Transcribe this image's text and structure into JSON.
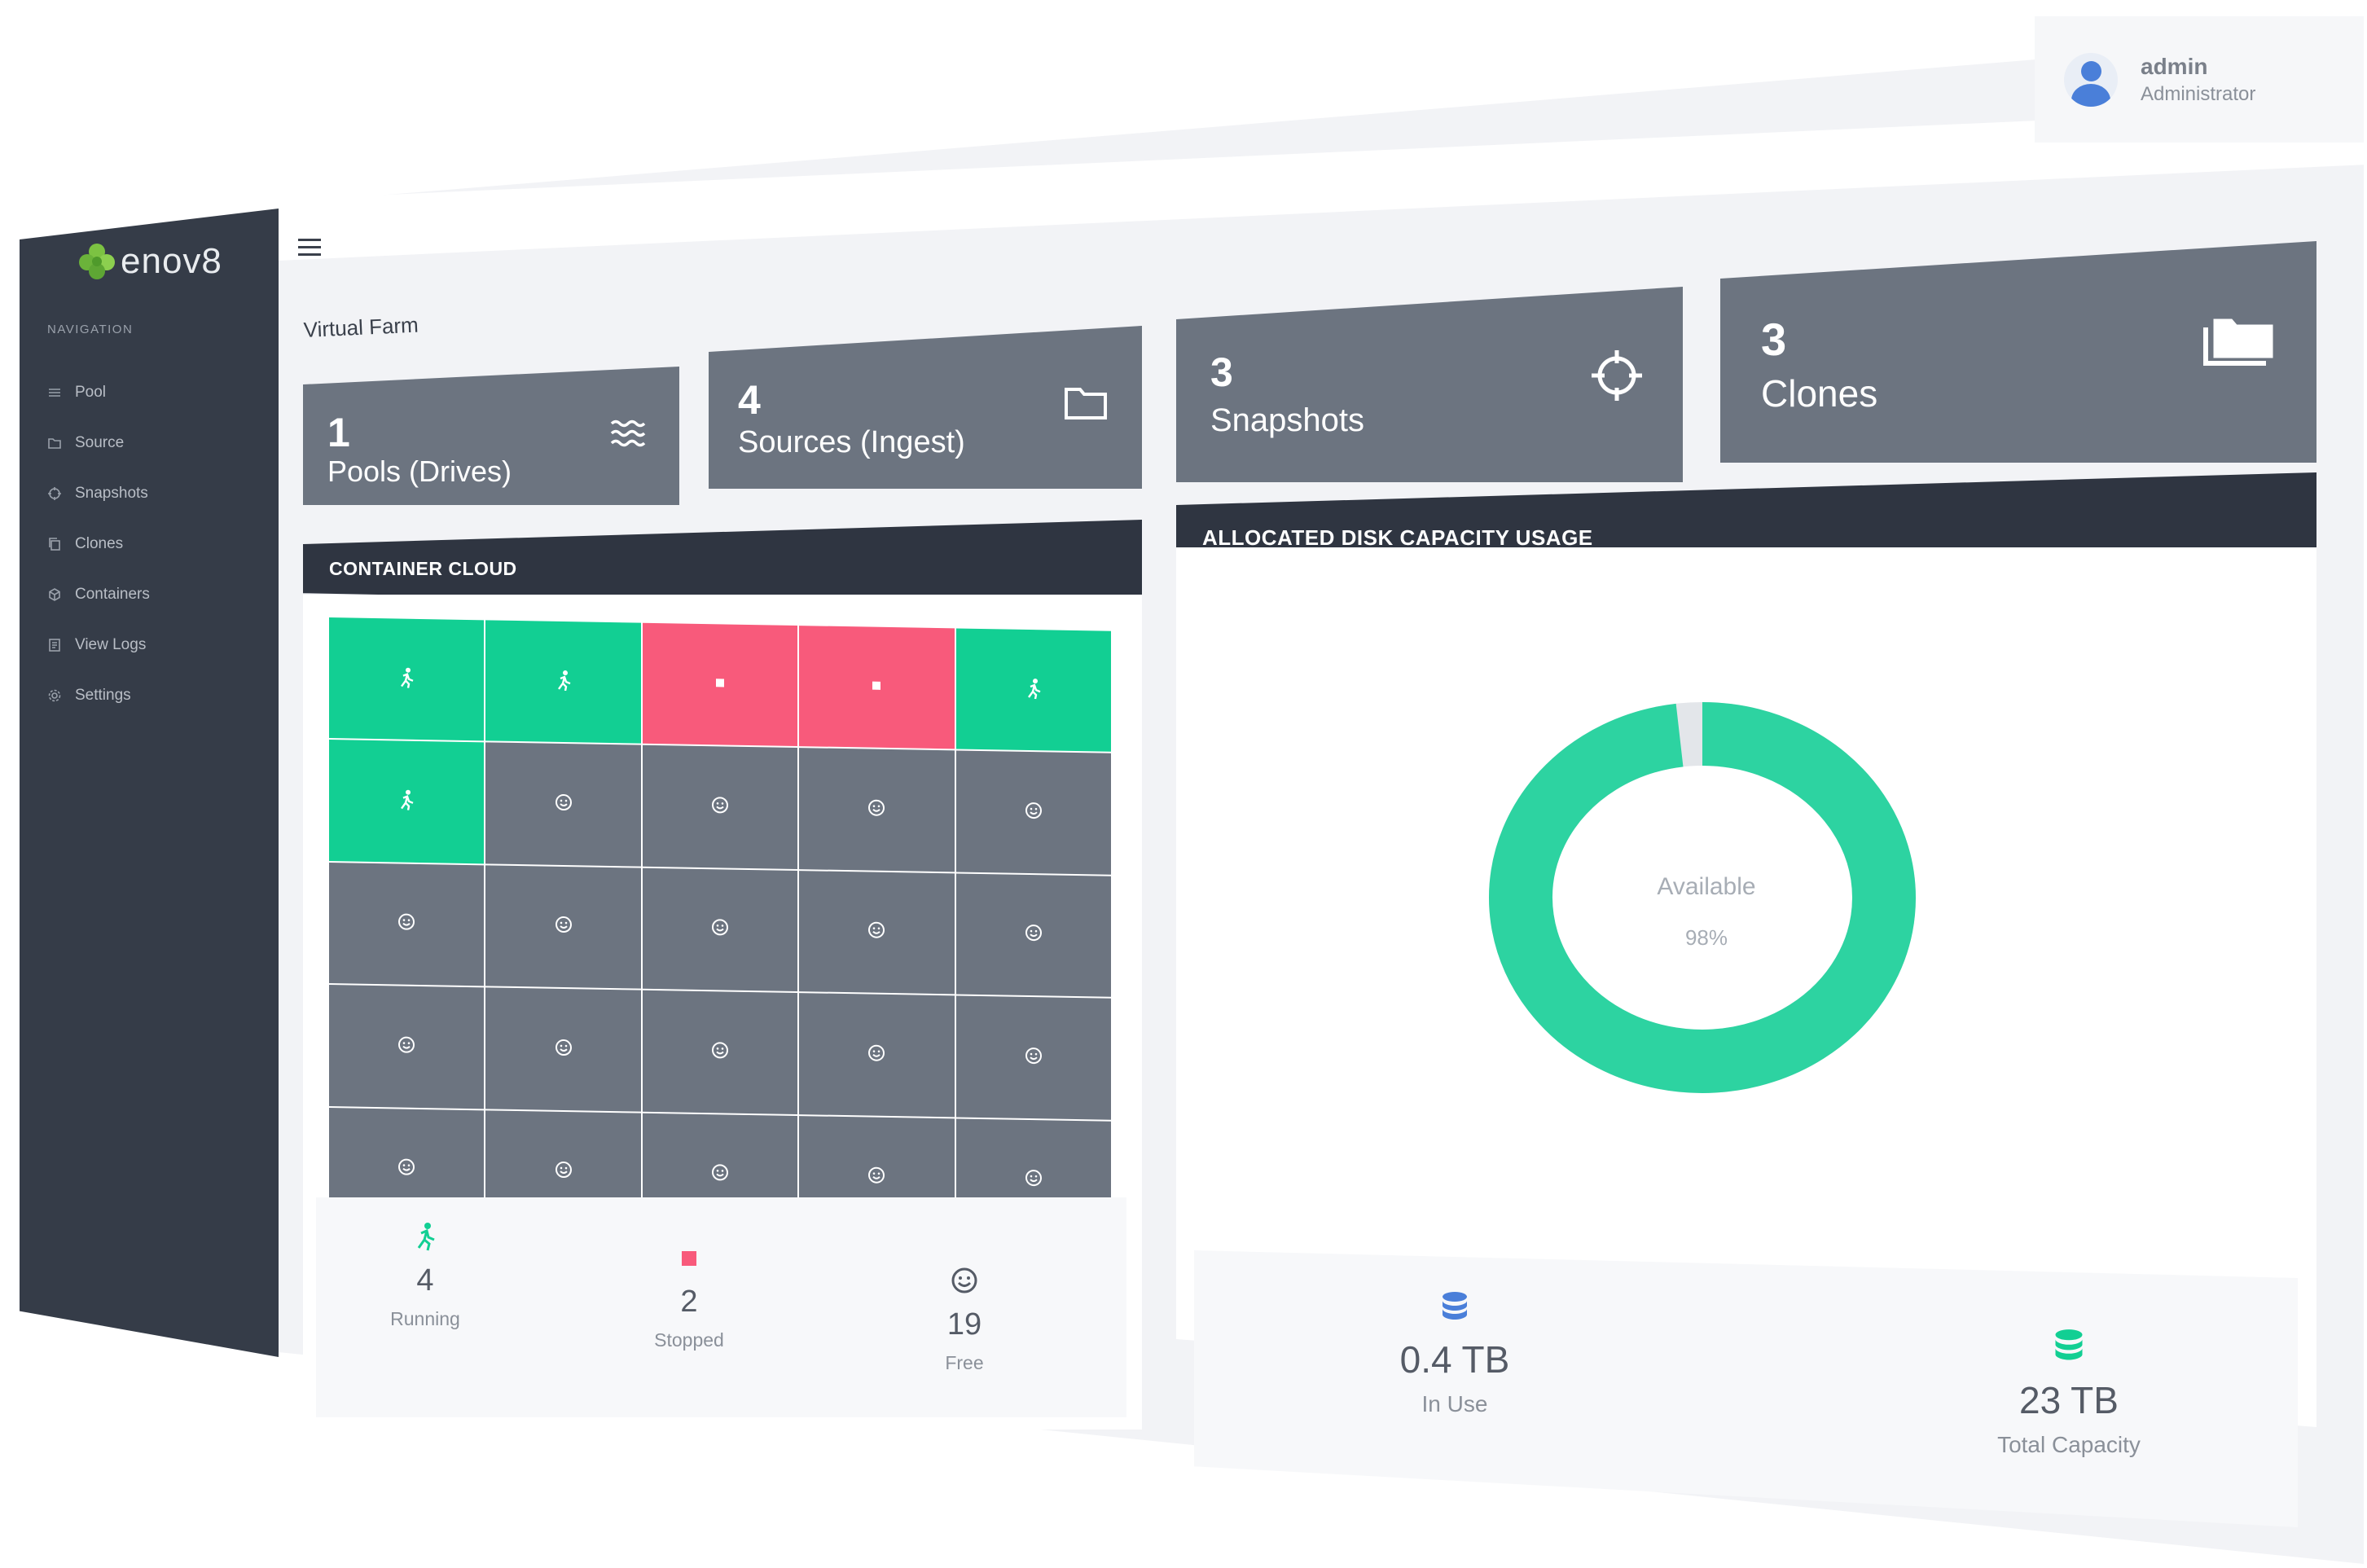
{
  "brand": {
    "name": "enov8"
  },
  "user": {
    "name": "admin",
    "role": "Administrator"
  },
  "sidebar": {
    "heading": "NAVIGATION",
    "items": [
      {
        "label": "Pool",
        "icon": "list-icon"
      },
      {
        "label": "Source",
        "icon": "folder-icon"
      },
      {
        "label": "Snapshots",
        "icon": "crosshair-icon"
      },
      {
        "label": "Clones",
        "icon": "copy-icon"
      },
      {
        "label": "Containers",
        "icon": "cube-icon"
      },
      {
        "label": "View Logs",
        "icon": "log-icon"
      },
      {
        "label": "Settings",
        "icon": "gear-icon"
      }
    ]
  },
  "page": {
    "breadcrumb": "Virtual Farm"
  },
  "stats": [
    {
      "value": "1",
      "label": "Pools (Drives)",
      "icon": "waves-icon"
    },
    {
      "value": "4",
      "label": "Sources (Ingest)",
      "icon": "folder-icon"
    },
    {
      "value": "3",
      "label": "Snapshots",
      "icon": "crosshair-icon"
    },
    {
      "value": "3",
      "label": "Clones",
      "icon": "folders-icon"
    }
  ],
  "container_cloud": {
    "title": "CONTAINER CLOUD",
    "cells": [
      "running",
      "running",
      "stopped",
      "stopped",
      "running",
      "running",
      "free",
      "free",
      "free",
      "free",
      "free",
      "free",
      "free",
      "free",
      "free",
      "free",
      "free",
      "free",
      "free",
      "free",
      "free",
      "free",
      "free",
      "free",
      "free"
    ],
    "legend": [
      {
        "count": "4",
        "label": "Running",
        "status": "running"
      },
      {
        "count": "2",
        "label": "Stopped",
        "status": "stopped"
      },
      {
        "count": "19",
        "label": "Free",
        "status": "free"
      }
    ],
    "colors": {
      "running": "#12cf93",
      "stopped": "#f85a7b",
      "free": "#6c7480"
    }
  },
  "disk": {
    "title": "ALLOCATED DISK CAPACITY USAGE",
    "center_label": "Available",
    "center_value": "98%",
    "available_fraction": 0.98,
    "ring_color": "#2dd3a1",
    "gap_color": "#e3e6ea",
    "in_use": {
      "value": "0.4 TB",
      "label": "In Use",
      "color": "#4a7fd9"
    },
    "total": {
      "value": "23 TB",
      "label": "Total Capacity",
      "color": "#12cf93"
    }
  }
}
